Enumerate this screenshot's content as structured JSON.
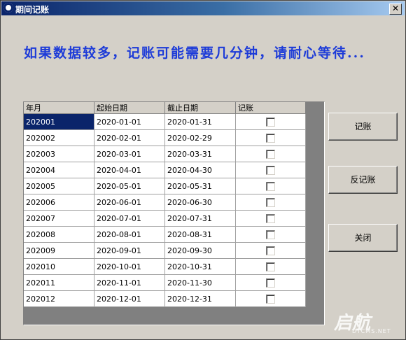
{
  "window": {
    "title": "期间记账",
    "close_symbol": "✕"
  },
  "message": "如果数据较多，记账可能需要几分钟，请耐心等待...",
  "grid": {
    "columns": [
      "年月",
      "起始日期",
      "截止日期",
      "记账"
    ],
    "rows": [
      {
        "period": "202001",
        "start": "2020-01-01",
        "end": "2020-01-31",
        "checked": false
      },
      {
        "period": "202002",
        "start": "2020-02-01",
        "end": "2020-02-29",
        "checked": false
      },
      {
        "period": "202003",
        "start": "2020-03-01",
        "end": "2020-03-31",
        "checked": false
      },
      {
        "period": "202004",
        "start": "2020-04-01",
        "end": "2020-04-30",
        "checked": false
      },
      {
        "period": "202005",
        "start": "2020-05-01",
        "end": "2020-05-31",
        "checked": false
      },
      {
        "period": "202006",
        "start": "2020-06-01",
        "end": "2020-06-30",
        "checked": false
      },
      {
        "period": "202007",
        "start": "2020-07-01",
        "end": "2020-07-31",
        "checked": false
      },
      {
        "period": "202008",
        "start": "2020-08-01",
        "end": "2020-08-31",
        "checked": false
      },
      {
        "period": "202009",
        "start": "2020-09-01",
        "end": "2020-09-30",
        "checked": false
      },
      {
        "period": "202010",
        "start": "2020-10-01",
        "end": "2020-10-31",
        "checked": false
      },
      {
        "period": "202011",
        "start": "2020-11-01",
        "end": "2020-11-30",
        "checked": false
      },
      {
        "period": "202012",
        "start": "2020-12-01",
        "end": "2020-12-31",
        "checked": false
      }
    ]
  },
  "buttons": {
    "post": "记账",
    "unpost": "反记账",
    "close": "关闭"
  },
  "watermark": {
    "logo": "启航",
    "url": "DTCMS.NET"
  }
}
